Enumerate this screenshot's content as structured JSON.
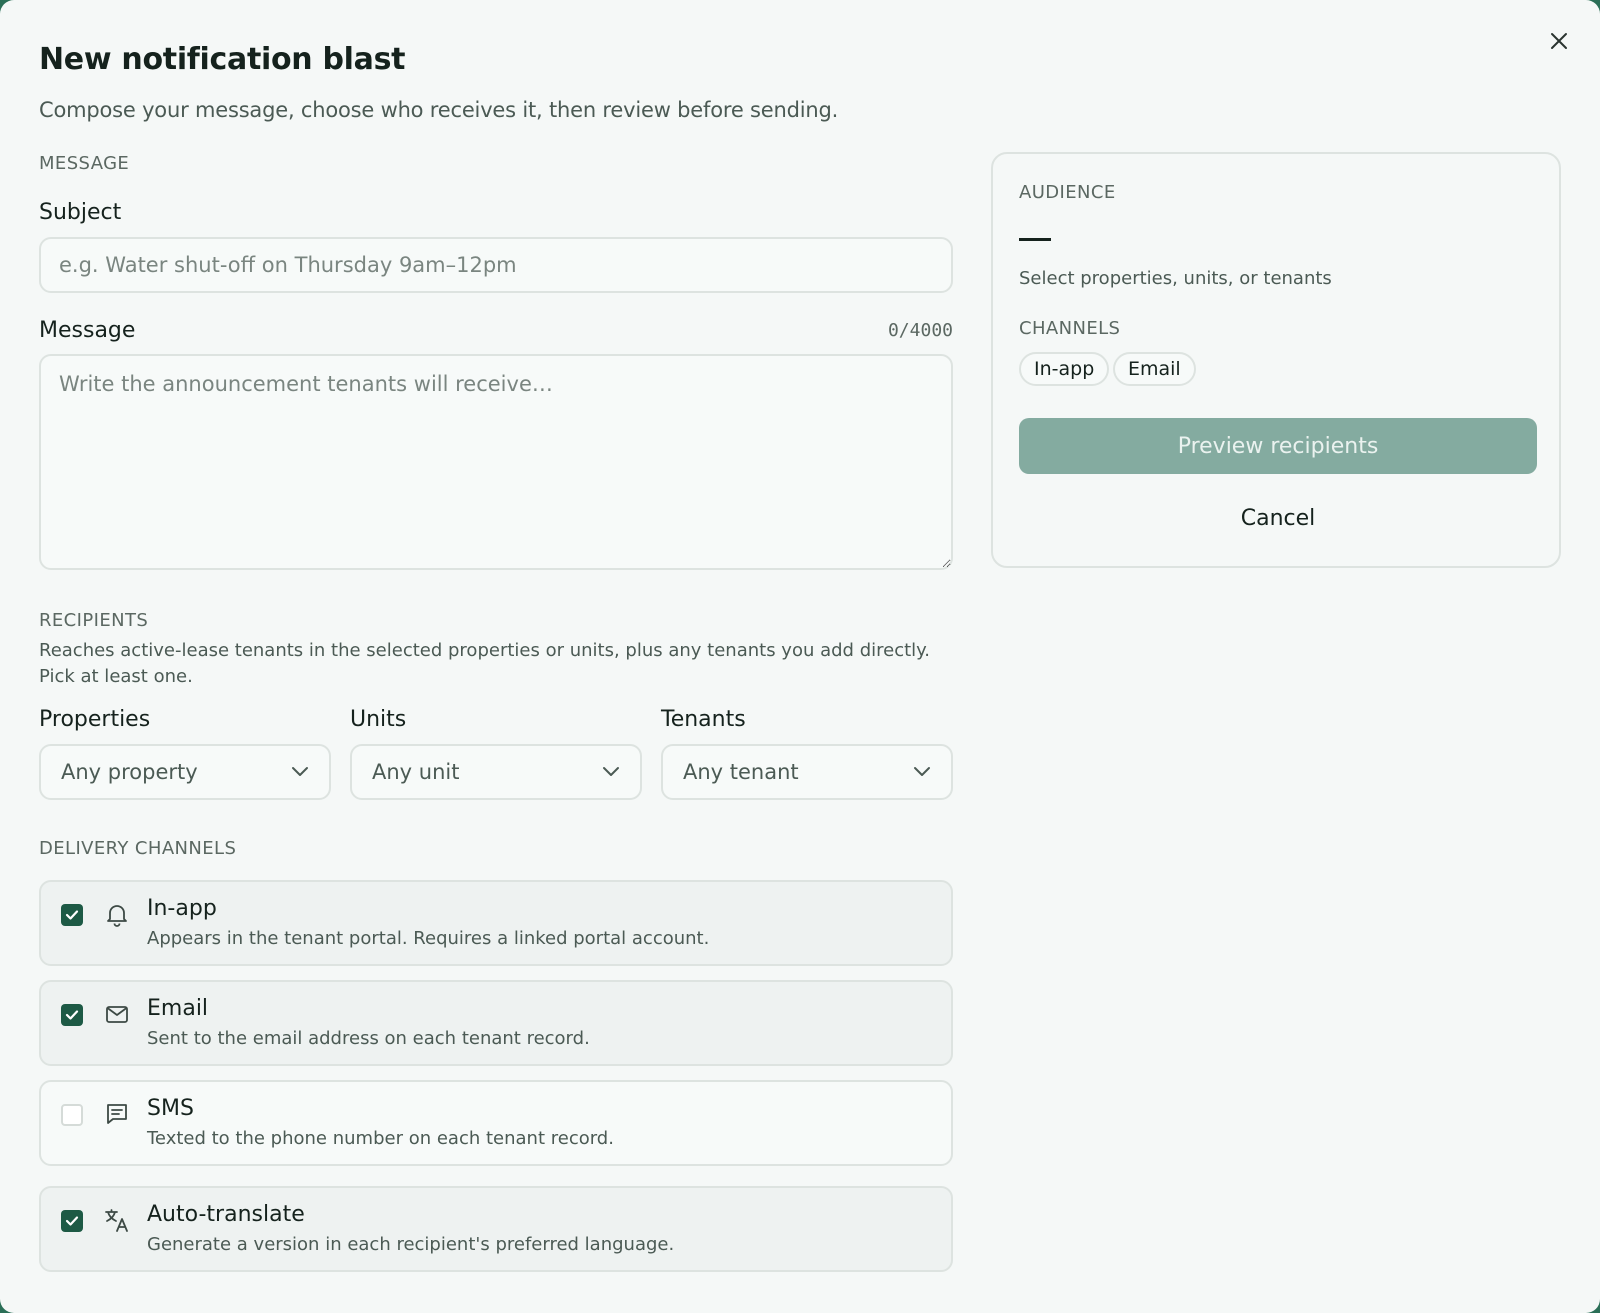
{
  "header": {
    "title": "New notification blast",
    "subtitle": "Compose your message, choose who receives it, then review before sending."
  },
  "message": {
    "section_label": "MESSAGE",
    "subject_label": "Subject",
    "subject_placeholder": "e.g. Water shut-off on Thursday 9am–12pm",
    "message_label": "Message",
    "counter": "0/4000",
    "message_placeholder": "Write the announcement tenants will receive…"
  },
  "recipients": {
    "section_label": "RECIPIENTS",
    "description": "Reaches active-lease tenants in the selected properties or units, plus any tenants you add directly. Pick at least one.",
    "properties_label": "Properties",
    "properties_value": "Any property",
    "units_label": "Units",
    "units_value": "Any unit",
    "tenants_label": "Tenants",
    "tenants_value": "Any tenant"
  },
  "delivery": {
    "section_label": "DELIVERY CHANNELS",
    "channels": [
      {
        "title": "In-app",
        "desc": "Appears in the tenant portal. Requires a linked portal account.",
        "checked": true,
        "icon": "bell-icon"
      },
      {
        "title": "Email",
        "desc": "Sent to the email address on each tenant record.",
        "checked": true,
        "icon": "mail-icon"
      },
      {
        "title": "SMS",
        "desc": "Texted to the phone number on each tenant record.",
        "checked": false,
        "icon": "message-icon"
      },
      {
        "title": "Auto-translate",
        "desc": "Generate a version in each recipient's preferred language.",
        "checked": true,
        "icon": "translate-icon"
      }
    ]
  },
  "audience": {
    "section_label": "AUDIENCE",
    "hint": "Select properties, units, or tenants",
    "channels_label": "CHANNELS",
    "chips": [
      "In-app",
      "Email"
    ],
    "preview_label": "Preview recipients",
    "cancel_label": "Cancel"
  },
  "colors": {
    "accent": "#1d5a45",
    "preview_button": "#84aba0",
    "border": "#dde3e0"
  }
}
